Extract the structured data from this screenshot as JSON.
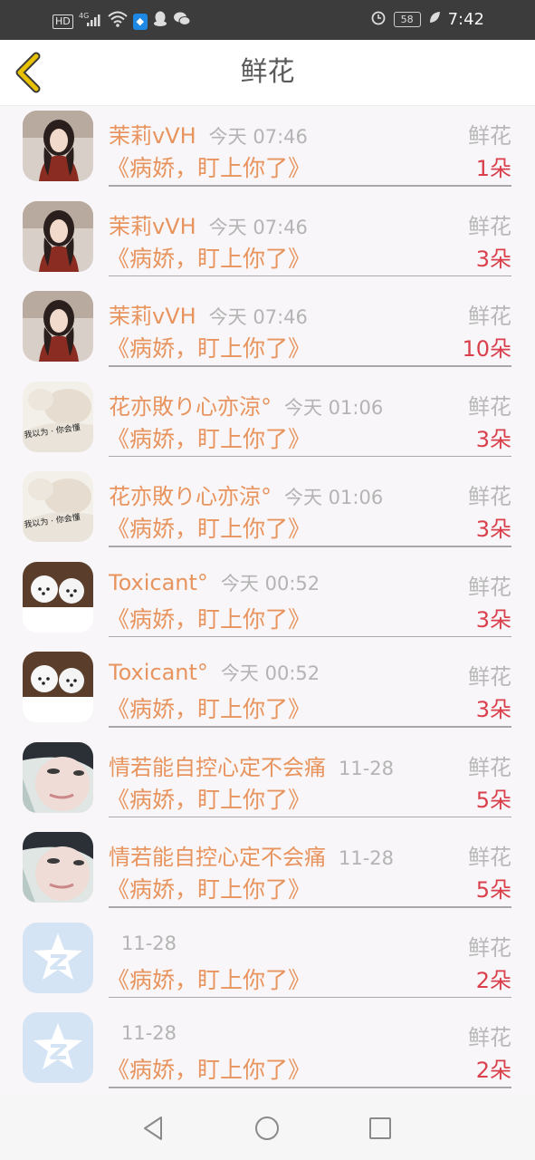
{
  "status": {
    "left_icons": [
      "hd-icon",
      "signal-icon",
      "wifi-icon",
      "shield-icon",
      "qq-icon",
      "wechat-icon"
    ],
    "network": "4G",
    "hd": "HD",
    "battery": "58",
    "time": "7:42"
  },
  "header": {
    "title": "鲜花"
  },
  "list": [
    {
      "name": "茉莉vVH",
      "time": "今天 07:46",
      "gift": "鲜花",
      "book": "《病娇，盯上你了》",
      "count": "1朵",
      "avatar": "girl"
    },
    {
      "name": "茉莉vVH",
      "time": "今天 07:46",
      "gift": "鲜花",
      "book": "《病娇，盯上你了》",
      "count": "3朵",
      "avatar": "girl"
    },
    {
      "name": "茉莉vVH",
      "time": "今天 07:46",
      "gift": "鲜花",
      "book": "《病娇，盯上你了》",
      "count": "10朵",
      "avatar": "girl"
    },
    {
      "name": "花亦敗り心亦涼°",
      "time": "今天 01:06",
      "gift": "鲜花",
      "book": "《病娇，盯上你了》",
      "count": "3朵",
      "avatar": "text"
    },
    {
      "name": "花亦敗り心亦涼°",
      "time": "今天 01:06",
      "gift": "鲜花",
      "book": "《病娇，盯上你了》",
      "count": "3朵",
      "avatar": "text"
    },
    {
      "name": "Toxicant°",
      "time": "今天 00:52",
      "gift": "鲜花",
      "book": "《病娇，盯上你了》",
      "count": "3朵",
      "avatar": "dogs"
    },
    {
      "name": "Toxicant°",
      "time": "今天 00:52",
      "gift": "鲜花",
      "book": "《病娇，盯上你了》",
      "count": "3朵",
      "avatar": "dogs"
    },
    {
      "name": "情若能自控心定不会痛",
      "time": "11-28",
      "gift": "鲜花",
      "book": "《病娇，盯上你了》",
      "count": "5朵",
      "avatar": "face"
    },
    {
      "name": "情若能自控心定不会痛",
      "time": "11-28",
      "gift": "鲜花",
      "book": "《病娇，盯上你了》",
      "count": "5朵",
      "avatar": "face"
    },
    {
      "name": "",
      "time": "11-28",
      "gift": "鲜花",
      "book": "《病娇，盯上你了》",
      "count": "2朵",
      "avatar": "qzone"
    },
    {
      "name": "",
      "time": "11-28",
      "gift": "鲜花",
      "book": "《病娇，盯上你了》",
      "count": "2朵",
      "avatar": "qzone"
    }
  ],
  "colors": {
    "accent": "#e8945e",
    "count": "#d9404c",
    "muted": "#b8b8b8",
    "back_arrow": "#e0b000"
  },
  "nav": {
    "icons": [
      "back-triangle-icon",
      "home-circle-icon",
      "recents-square-icon"
    ]
  }
}
